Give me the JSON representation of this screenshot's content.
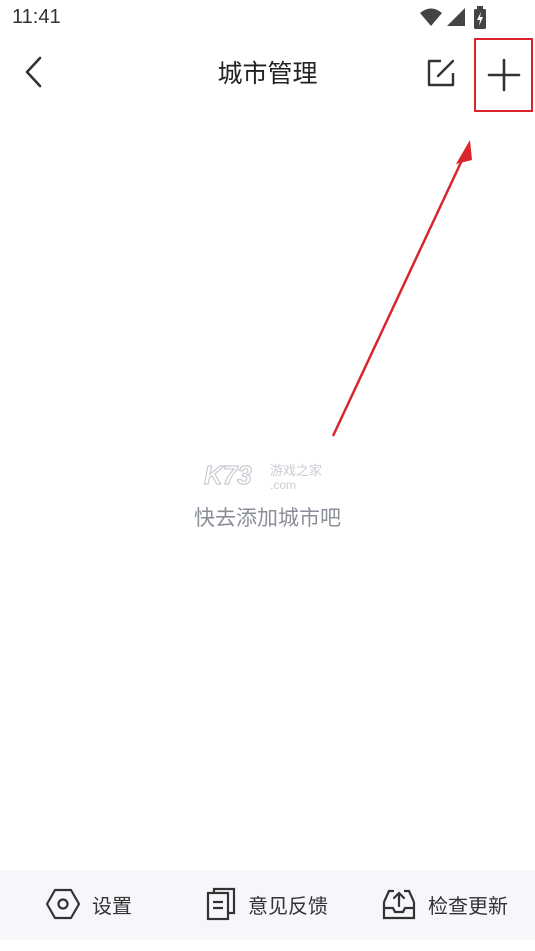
{
  "status_bar": {
    "time": "11:41"
  },
  "header": {
    "title": "城市管理"
  },
  "empty_state": {
    "message": "快去添加城市吧",
    "watermark": "K73 游戏之家 .com"
  },
  "bottom_bar": {
    "items": [
      {
        "label": "设置",
        "icon": "settings-hexagon-icon"
      },
      {
        "label": "意见反馈",
        "icon": "document-feedback-icon"
      },
      {
        "label": "检查更新",
        "icon": "tray-upload-icon"
      }
    ]
  },
  "colors": {
    "annotation": "#d9252b",
    "bottom_bar_bg": "#f6f7fa",
    "empty_text": "#8a8f97"
  }
}
